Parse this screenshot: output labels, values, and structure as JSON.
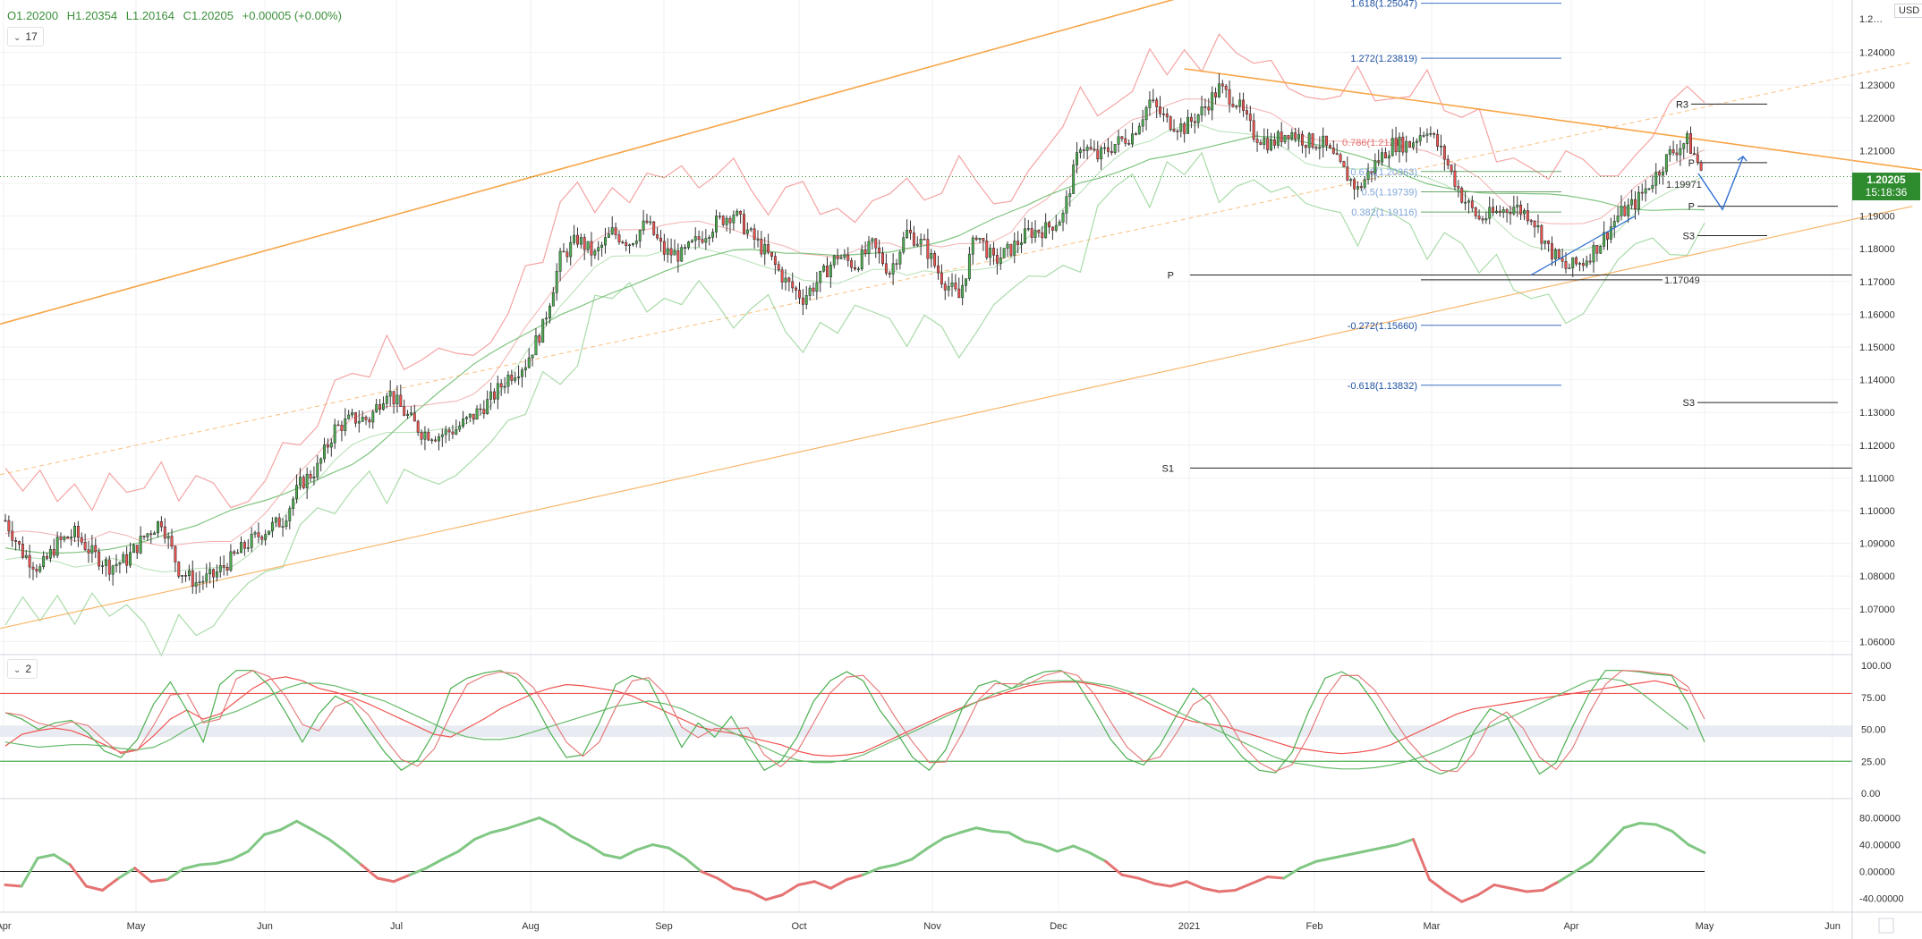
{
  "legend": {
    "open": "O1.20200",
    "high": "H1.20354",
    "low": "L1.20164",
    "close": "C1.20205",
    "change": "+0.00005 (+0.00%)"
  },
  "panes": {
    "main_badge": "17",
    "osc_badge": "2"
  },
  "currency": "USD",
  "last_price": {
    "value": "1.20205",
    "countdown": "15:18:36"
  },
  "colors": {
    "up": "#4caf50",
    "down": "#ef5350",
    "accent_green": "#2e8b2e",
    "trend_orange": "#f7a547",
    "fib_blue": "#1e50a0"
  },
  "chart_data": {
    "type": "candlestick",
    "symbol_currency": "USD",
    "x_labels": [
      "Apr",
      "May",
      "Jun",
      "Jul",
      "Aug",
      "Sep",
      "Oct",
      "Nov",
      "Dec",
      "2021",
      "Feb",
      "Mar",
      "Apr",
      "May",
      "Jun"
    ],
    "price_axis": {
      "ticks": [
        "1.24000",
        "1.23000",
        "1.22000",
        "1.21000",
        "1.20000",
        "1.19000",
        "1.18000",
        "1.17000",
        "1.16000",
        "1.15000",
        "1.14000",
        "1.13000",
        "1.12000",
        "1.11000",
        "1.10000",
        "1.09000",
        "1.08000",
        "1.07000",
        "1.06000"
      ],
      "top_tick": "1.2…",
      "ylim": [
        1.056,
        1.256
      ]
    },
    "weekly_closes": [
      1.097,
      1.087,
      1.082,
      1.09,
      1.093,
      1.087,
      1.083,
      1.085,
      1.092,
      1.097,
      1.082,
      1.078,
      1.08,
      1.085,
      1.09,
      1.094,
      1.097,
      1.108,
      1.113,
      1.125,
      1.128,
      1.128,
      1.137,
      1.13,
      1.124,
      1.123,
      1.125,
      1.129,
      1.134,
      1.141,
      1.145,
      1.156,
      1.177,
      1.183,
      1.178,
      1.185,
      1.182,
      1.188,
      1.179,
      1.178,
      1.183,
      1.188,
      1.191,
      1.184,
      1.178,
      1.17,
      1.165,
      1.171,
      1.178,
      1.175,
      1.181,
      1.173,
      1.185,
      1.181,
      1.171,
      1.165,
      1.185,
      1.176,
      1.18,
      1.185,
      1.186,
      1.19,
      1.212,
      1.208,
      1.212,
      1.215,
      1.225,
      1.219,
      1.217,
      1.222,
      1.229,
      1.225,
      1.215,
      1.212,
      1.216,
      1.213,
      1.212,
      1.205,
      1.198,
      1.206,
      1.212,
      1.212,
      1.217,
      1.208,
      1.196,
      1.189,
      1.191,
      1.193,
      1.19,
      1.18,
      1.174,
      1.176,
      1.182,
      1.19,
      1.194,
      1.201,
      1.209,
      1.213,
      1.202
    ],
    "levels": [
      {
        "label": "R3",
        "price": 1.2242
      },
      {
        "label": "P",
        "price": 1.2063
      },
      {
        "label": "P",
        "price": 1.193
      },
      {
        "label": "S3",
        "price": 1.184
      },
      {
        "label": "P",
        "price": 1.172
      },
      {
        "label": "S3",
        "price": 1.133
      },
      {
        "label": "S1",
        "price": 1.113
      }
    ],
    "fib_levels": [
      {
        "label": "1.618(1.25047)",
        "price": 1.255
      },
      {
        "label": "1.272(1.23819)",
        "price": 1.2382
      },
      {
        "label": "0.618(1.20363)",
        "price": 1.2036
      },
      {
        "label": "0.5(1.19739)",
        "price": 1.1974
      },
      {
        "label": "0.382(1.19116)",
        "price": 1.1912
      },
      {
        "label": "-0.272(1.15660)",
        "price": 1.1566
      },
      {
        "label": "-0.618(1.13832)",
        "price": 1.1383
      }
    ],
    "fib_inline_labels": [
      {
        "label": "0.786(1.2121)",
        "price": 1.2125
      },
      {
        "label": "1.19971",
        "price": 1.1997
      },
      {
        "label": "1.17049",
        "price": 1.1705
      }
    ],
    "oscillator": {
      "ticks": [
        "100.00",
        "75.00",
        "50.00",
        "25.00",
        "0.00"
      ],
      "ylim": [
        0,
        100
      ],
      "upper_line": 78,
      "lower_line": 25,
      "band": [
        44,
        53
      ],
      "fast": [
        63,
        58,
        50,
        55,
        57,
        47,
        33,
        28,
        42,
        70,
        87,
        65,
        40,
        85,
        96,
        96,
        84,
        63,
        40,
        62,
        76,
        69,
        50,
        32,
        18,
        26,
        48,
        82,
        90,
        94,
        96,
        90,
        72,
        48,
        28,
        30,
        55,
        85,
        92,
        88,
        62,
        36,
        55,
        44,
        60,
        38,
        18,
        25,
        44,
        72,
        88,
        95,
        88,
        65,
        48,
        28,
        18,
        34,
        66,
        84,
        88,
        82,
        90,
        95,
        96,
        86,
        65,
        42,
        27,
        22,
        38,
        61,
        82,
        70,
        44,
        28,
        18,
        16,
        32,
        64,
        90,
        95,
        88,
        70,
        48,
        32,
        20,
        15,
        20,
        48,
        66,
        60,
        37,
        15,
        24,
        52,
        78,
        96,
        96,
        95,
        93,
        92,
        70,
        40
      ],
      "slow": [
        37,
        46,
        49,
        51,
        49,
        44,
        38,
        32,
        34,
        45,
        58,
        65,
        58,
        62,
        72,
        82,
        89,
        91,
        88,
        82,
        79,
        75,
        70,
        64,
        58,
        52,
        46,
        44,
        51,
        58,
        66,
        72,
        78,
        82,
        85,
        84,
        82,
        80,
        76,
        70,
        64,
        58,
        52,
        49,
        47,
        44,
        41,
        38,
        33,
        30,
        29,
        30,
        32,
        38,
        44,
        50,
        56,
        62,
        67,
        72,
        76,
        80,
        84,
        86,
        87,
        87,
        85,
        82,
        78,
        72,
        66,
        60,
        56,
        54,
        52,
        48,
        44,
        40,
        36,
        34,
        32,
        31,
        32,
        34,
        38,
        44,
        50,
        56,
        62,
        66,
        68,
        70,
        72,
        74,
        76,
        78,
        80,
        82,
        84,
        86,
        88,
        85,
        80
      ],
      "signal": [
        40,
        38,
        36,
        37,
        38,
        38,
        37,
        35,
        34,
        36,
        42,
        50,
        56,
        60,
        64,
        70,
        76,
        82,
        86,
        86,
        84,
        80,
        76,
        72,
        66,
        60,
        54,
        48,
        44,
        42,
        42,
        44,
        48,
        52,
        56,
        60,
        64,
        68,
        70,
        72,
        70,
        66,
        60,
        54,
        48,
        42,
        36,
        30,
        26,
        24,
        24,
        26,
        30,
        36,
        42,
        48,
        54,
        60,
        66,
        72,
        78,
        82,
        86,
        88,
        88,
        88,
        86,
        84,
        80,
        76,
        70,
        64,
        58,
        52,
        46,
        40,
        34,
        28,
        24,
        22,
        20,
        19,
        19,
        20,
        22,
        25,
        29,
        34,
        40,
        46,
        52,
        58,
        64,
        70,
        76,
        82,
        88,
        90,
        88,
        80,
        70,
        60,
        50
      ]
    },
    "histogram": {
      "ticks": [
        "80.00000",
        "40.00000",
        "0.00000",
        "-40.00000"
      ],
      "ylim": [
        -50,
        90
      ],
      "values": [
        -20,
        -22,
        20,
        25,
        10,
        -22,
        -28,
        -10,
        5,
        -15,
        -12,
        4,
        10,
        12,
        18,
        30,
        55,
        62,
        75,
        62,
        48,
        30,
        10,
        -10,
        -15,
        -5,
        5,
        18,
        30,
        48,
        58,
        64,
        72,
        80,
        68,
        52,
        40,
        25,
        20,
        32,
        40,
        35,
        20,
        0,
        -10,
        -25,
        -30,
        -42,
        -35,
        -20,
        -15,
        -25,
        -12,
        -5,
        5,
        10,
        18,
        35,
        50,
        58,
        65,
        60,
        58,
        45,
        40,
        30,
        38,
        28,
        15,
        -5,
        -10,
        -18,
        -22,
        -15,
        -25,
        -30,
        -28,
        -18,
        -8,
        -10,
        5,
        15,
        20,
        25,
        30,
        35,
        40,
        48,
        -12,
        -30,
        -45,
        -35,
        -20,
        -25,
        -30,
        -28,
        -15,
        0,
        15,
        40,
        65,
        72,
        70,
        60,
        40,
        28
      ]
    },
    "date_marks": [
      "Apr",
      "May",
      "Jun",
      "Jul",
      "Aug",
      "Sep",
      "Oct",
      "Nov",
      "Dec",
      "2021",
      "Feb",
      "Mar",
      "Apr",
      "May",
      "Jun"
    ]
  }
}
